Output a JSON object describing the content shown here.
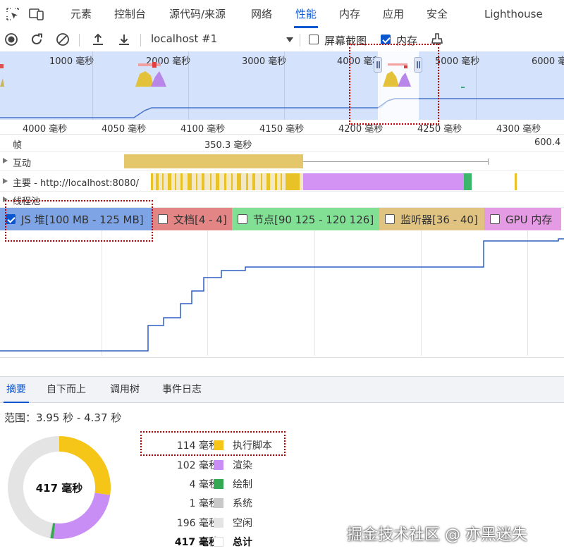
{
  "tabs": [
    {
      "label": "元素"
    },
    {
      "label": "控制台"
    },
    {
      "label": "源代码/来源"
    },
    {
      "label": "网络"
    },
    {
      "label": "性能"
    },
    {
      "label": "内存"
    },
    {
      "label": "应用"
    },
    {
      "label": "安全"
    },
    {
      "label": "Lighthouse"
    }
  ],
  "toolbar": {
    "target": "localhost #1",
    "screenshots_label": "屏幕截图",
    "screenshots_checked": false,
    "memory_label": "内存",
    "memory_checked": true
  },
  "overview": {
    "ticks": [
      "1000 毫秒",
      "2000 毫秒",
      "3000 毫秒",
      "4000 毫秒",
      "5000 毫秒",
      "6000 毫秒"
    ]
  },
  "ruler": {
    "ticks": [
      "4000 毫秒",
      "4050 毫秒",
      "4100 毫秒",
      "4150 毫秒",
      "4200 毫秒",
      "4250 毫秒",
      "4300 毫秒"
    ]
  },
  "tracks": {
    "frames_label": "帧",
    "frame_time_1": "350.3 毫秒",
    "frame_time_2": "600.4",
    "interactions_label": "互动",
    "main_label": "主要 - http://localhost:8080/",
    "thread_pool_label": "线程池"
  },
  "counters": [
    {
      "label": "JS 堆[100 MB - 125 MB]",
      "checked": true,
      "color": "#7ea4e5"
    },
    {
      "label": "文档[4 - 4]",
      "checked": false,
      "color": "#e48585"
    },
    {
      "label": "节点[90 125 - 120 126]",
      "checked": false,
      "color": "#82e095"
    },
    {
      "label": "监听器[36 - 40]",
      "checked": false,
      "color": "#e1c381"
    },
    {
      "label": "GPU 内存",
      "checked": false,
      "color": "#e59be3"
    }
  ],
  "bottom_tabs": [
    {
      "label": "摘要"
    },
    {
      "label": "自下而上"
    },
    {
      "label": "调用树"
    },
    {
      "label": "事件日志"
    }
  ],
  "summary": {
    "range": "范围：3.95 秒 - 4.37 秒",
    "total_center": "417 毫秒",
    "rows": [
      {
        "time": "114 毫秒",
        "label": "执行脚本",
        "color": "#f5c518",
        "value": 114
      },
      {
        "time": "102 毫秒",
        "label": "渲染",
        "color": "#c98ef5",
        "value": 102
      },
      {
        "time": "4 毫秒",
        "label": "绘制",
        "color": "#34a853",
        "value": 4
      },
      {
        "time": "1 毫秒",
        "label": "系统",
        "color": "#c8c8c8",
        "value": 1
      },
      {
        "time": "196 毫秒",
        "label": "空闲",
        "color": "#e4e4e4",
        "value": 196
      },
      {
        "time": "417 毫秒",
        "label": "总计",
        "color": "#ffffff",
        "value": 417
      }
    ]
  },
  "watermark": "掘金技术社区 @ 亦黑迷失"
}
